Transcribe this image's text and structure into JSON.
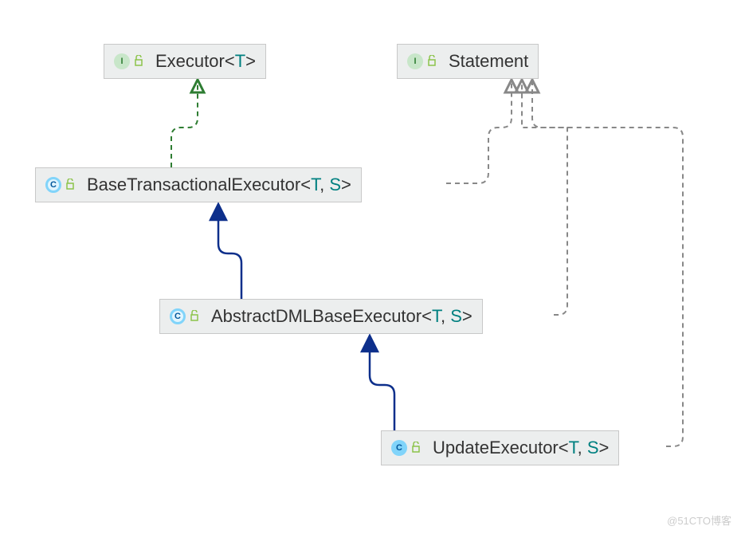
{
  "nodes": {
    "executor": {
      "name": "Executor",
      "generic": "<T>",
      "kind": "interface",
      "iconLetter": "I"
    },
    "statement": {
      "name": "Statement",
      "generic": "",
      "kind": "interface",
      "iconLetter": "I"
    },
    "baseTransactional": {
      "name": "BaseTransactionalExecutor",
      "generic": "<T, S>",
      "kind": "abstract-class",
      "iconLetter": "C"
    },
    "abstractDml": {
      "name": "AbstractDMLBaseExecutor",
      "generic": "<T, S>",
      "kind": "abstract-class",
      "iconLetter": "C"
    },
    "updateExecutor": {
      "name": "UpdateExecutor",
      "generic": "<T, S>",
      "kind": "class",
      "iconLetter": "C"
    }
  },
  "watermark": "@51CTO博客"
}
